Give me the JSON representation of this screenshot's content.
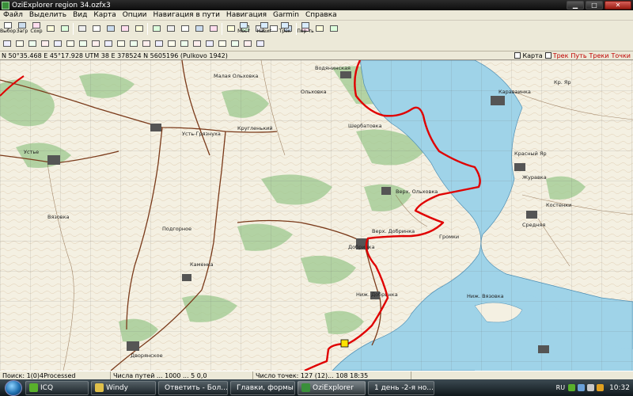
{
  "window": {
    "title": "OziExplorer   region 34.ozfx3"
  },
  "menu": [
    "Файл",
    "Выделить",
    "Вид",
    "Карта",
    "Опции",
    "Навигация в пути",
    "Навигация",
    "Garmin",
    "Справка"
  ],
  "toolbar": {
    "row1": [
      "Выбор",
      "Загр",
      "Сохр"
    ],
    "row2_right": [
      "Мост",
      "Навиг",
      "Трек",
      "Пер-ть"
    ],
    "row_labels": [
      "Вкл",
      "Загр",
      "Сохр",
      "Меню",
      "Загр"
    ]
  },
  "infobar": {
    "coords": "N 50°35.468  E 45°17.928   UTM 38  E 378524  N 5605196  (Pulkovo 1942)",
    "right_labels": [
      "Карта",
      "Трек",
      "Путь",
      "Треки",
      "Точки"
    ]
  },
  "map": {
    "labels": [
      "Водянинская",
      "Малая Ольховка",
      "Ольховка",
      "Кругленький",
      "Верх. Ольховка",
      "Верх. Добринка",
      "Добринка",
      "Ниж. Добринка",
      "Громки",
      "Шербатовка",
      "Усть-Грязнуха",
      "Устье",
      "Красный Яр",
      "Караваинка",
      "Ниж. Вязовка",
      "Костенки",
      "Подгорное",
      "Вязовка",
      "Средняя",
      "Журавка",
      "Дворянское",
      "Каменка",
      "Кр. Яр"
    ],
    "track_color": "#e00000",
    "water_color": "#9fd3e8"
  },
  "statusbar": {
    "cells": [
      "Поиск: 1(0)4Processed",
      "Числа путей ... 1000 ... 5 0,0",
      "Число точек: 127 (12)... 108 18:35"
    ]
  },
  "taskbar": {
    "tasks": [
      {
        "label": "ICQ",
        "color": "#59b02b"
      },
      {
        "label": "Windy",
        "color": "#e0c04a"
      },
      {
        "label": "Ответить - Бол...",
        "color": "#ff7a1c"
      },
      {
        "label": "Главки, формы",
        "color": "#ffcc33"
      },
      {
        "label": "OziExplorer",
        "color": "#3a8f3a"
      },
      {
        "label": "1 день -2-я но...",
        "color": "#ff7a1c"
      }
    ],
    "lang": "RU",
    "clock": "10:32"
  }
}
